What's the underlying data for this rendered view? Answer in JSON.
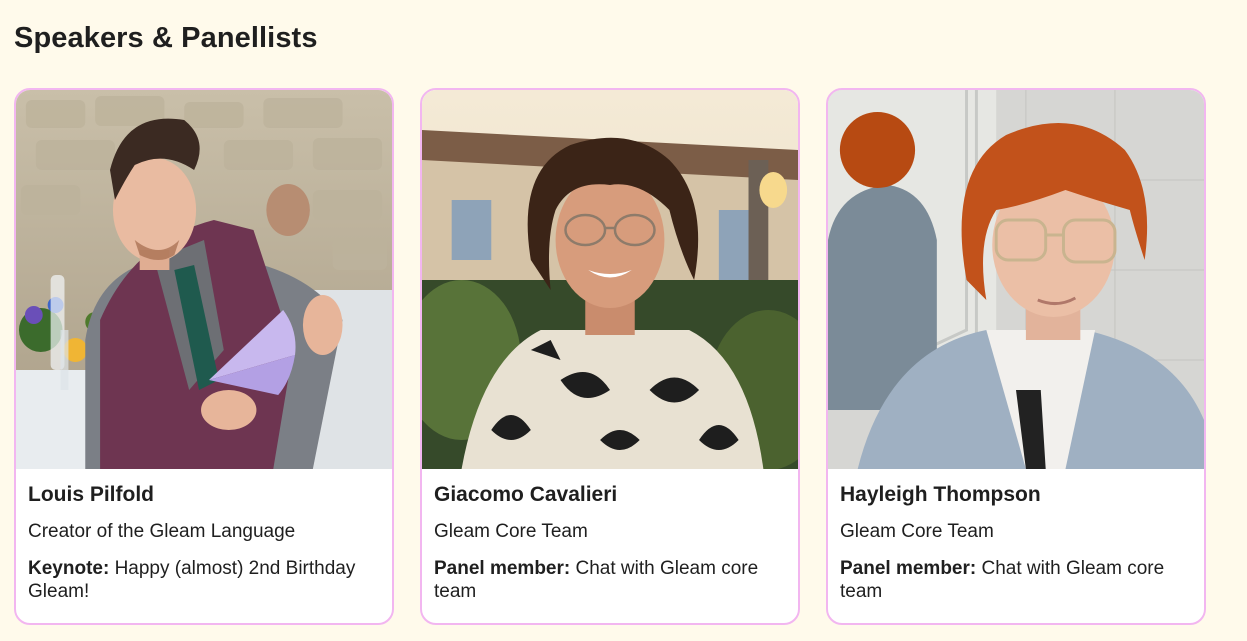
{
  "section": {
    "title": "Speakers & Panellists"
  },
  "speakers": [
    {
      "name": "Louis Pilfold",
      "role": "Creator of the Gleam Language",
      "talk_label": "Keynote:",
      "talk_title": "Happy (almost) 2nd Birthday Gleam!"
    },
    {
      "name": "Giacomo Cavalieri",
      "role": "Gleam Core Team",
      "talk_label": "Panel member:",
      "talk_title": "Chat with Gleam core team"
    },
    {
      "name": "Hayleigh Thompson",
      "role": "Gleam Core Team",
      "talk_label": "Panel member:",
      "talk_title": "Chat with Gleam core team"
    }
  ],
  "colors": {
    "page_background": "#fffaeb",
    "card_border": "#f2b6f0",
    "card_background": "#ffffff",
    "text": "#1f1f1f"
  }
}
